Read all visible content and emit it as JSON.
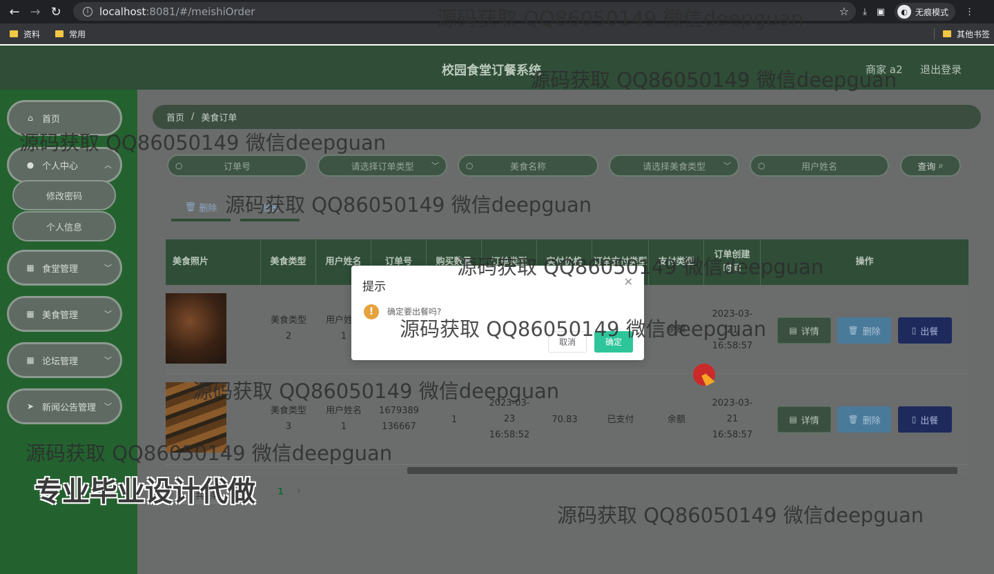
{
  "browser": {
    "url_host": "localhost",
    "url_path": ":8081/#/meishiOrder",
    "incognito_label": "无痕模式",
    "bookmarks": [
      "资料",
      "常用"
    ],
    "other_bookmarks": "其他书签"
  },
  "header": {
    "title": "校园食堂订餐系统",
    "user": "商家 a2",
    "logout": "退出登录"
  },
  "sidebar": {
    "home": "首页",
    "personal_center": "个人中心",
    "change_password": "修改密码",
    "personal_info": "个人信息",
    "canteen_mgmt": "食堂管理",
    "food_mgmt": "美食管理",
    "forum_mgmt": "论坛管理",
    "news_mgmt": "新闻公告管理"
  },
  "breadcrumb": {
    "home": "首页",
    "sep": "/",
    "current": "美食订单"
  },
  "filters": {
    "order_no": "订单号",
    "order_type": "请选择订单类型",
    "food_name": "美食名称",
    "food_type": "请选择美食类型",
    "user_name": "用户姓名",
    "query": "查询"
  },
  "toolbar": {
    "delete": "删除",
    "report": "报表"
  },
  "table": {
    "headers": [
      "美食照片",
      "美食类型",
      "用户姓名",
      "订单号",
      "购买数量",
      "订单类型",
      "实付价格",
      "订单支付类型",
      "支付类型",
      "订单创建时间",
      "操作"
    ],
    "rows": [
      {
        "food_type": "美食类型2",
        "user": "用户姓名1",
        "order_no": "",
        "qty": "",
        "order_time": "",
        "price": "",
        "status": "",
        "pay": "余额",
        "created": "2023-03-21 16:58:57"
      },
      {
        "food_type": "美食类型3",
        "user": "用户姓名1",
        "order_no": "1679389136667",
        "qty": "1",
        "order_time": "2023-03-23 16:58:52",
        "price": "70.83",
        "status": "已支付",
        "pay": "余额",
        "created": "2023-03-21 16:58:57"
      }
    ],
    "actions": {
      "detail": "详情",
      "delete": "删除",
      "serve": "出餐"
    }
  },
  "pagination": {
    "total": "共2条",
    "page": "1"
  },
  "modal": {
    "title": "提示",
    "message": "确定要出餐吗?",
    "cancel": "取消",
    "confirm": "确定"
  },
  "watermark": {
    "text": "源码获取 QQ86050149 微信deepguan",
    "banner": "专业毕业设计代做"
  },
  "colors": {
    "header": "#2f4d37",
    "sidebar": "#23622f",
    "confirm": "#2fc59b",
    "warning": "#e6a23c"
  }
}
